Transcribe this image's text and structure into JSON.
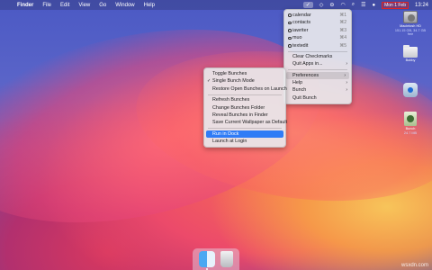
{
  "menubar": {
    "apple": "",
    "items": [
      "Finder",
      "File",
      "Edit",
      "View",
      "Go",
      "Window",
      "Help"
    ],
    "date_badge": "Mon 1 Feb",
    "clock": "13:24"
  },
  "bunch_menu": {
    "bunches": [
      {
        "label": "calendar",
        "shortcut": "⌘1"
      },
      {
        "label": "contacts",
        "shortcut": "⌘2"
      },
      {
        "label": "iawriter",
        "shortcut": "⌘3"
      },
      {
        "label": "muo",
        "shortcut": "⌘4"
      },
      {
        "label": "textedit",
        "shortcut": "⌘5"
      }
    ],
    "clear_checkmarks": "Clear Checkmarks",
    "quit_apps": "Quit Apps in...",
    "preferences": "Preferences",
    "help": "Help",
    "bunch": "Bunch",
    "quit_bunch": "Quit Bunch"
  },
  "preferences_menu": {
    "toggle_bunches": "Toggle Bunches",
    "single_bunch_mode": "Single Bunch Mode",
    "restore_open": "Restore Open Bunches on Launch",
    "refresh_bunches": "Refresh Bunches",
    "change_folder": "Change Bunches Folder",
    "reveal_finder": "Reveal Bunches in Finder",
    "save_wallpaper": "Save Current Wallpaper as Default",
    "run_in_dock": "Run in Dock",
    "launch_at_login": "Launch at Login"
  },
  "desktop_icons": {
    "hd_name": "Macintosh HD",
    "hd_info": "151.15 GB, 34.7 GB free",
    "folder_name": "Bobby",
    "bunch_name": "Bunch",
    "bunch_info": "24.7 MB"
  },
  "watermark": "wsxdn.com"
}
